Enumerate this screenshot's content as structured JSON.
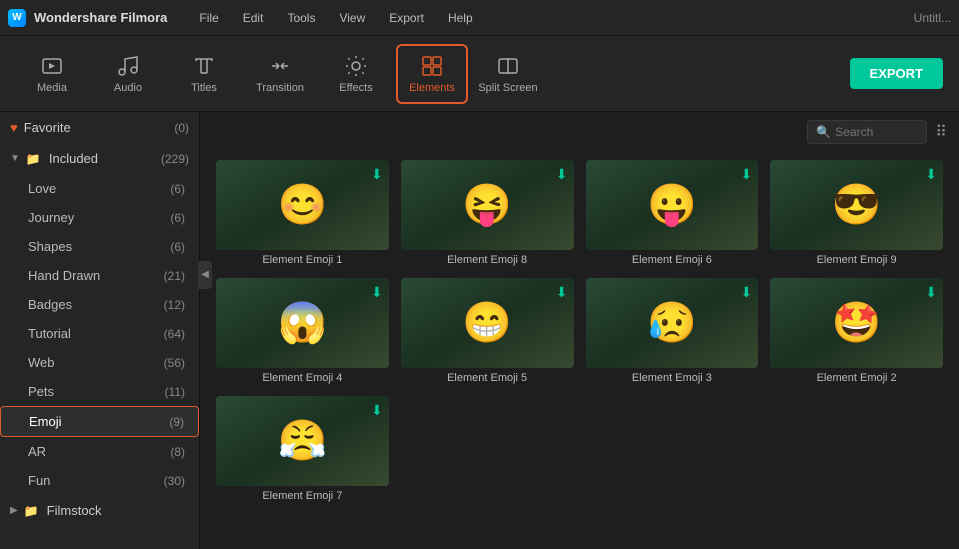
{
  "app": {
    "name": "Wondershare Filmora",
    "window_title": "Untitl..."
  },
  "menu": [
    "File",
    "Edit",
    "Tools",
    "View",
    "Export",
    "Help"
  ],
  "toolbar": {
    "export_label": "EXPORT",
    "buttons": [
      {
        "id": "media",
        "label": "Media",
        "icon": "media"
      },
      {
        "id": "audio",
        "label": "Audio",
        "icon": "audio"
      },
      {
        "id": "titles",
        "label": "Titles",
        "icon": "titles"
      },
      {
        "id": "transition",
        "label": "Transition",
        "icon": "transition"
      },
      {
        "id": "effects",
        "label": "Effects",
        "icon": "effects"
      },
      {
        "id": "elements",
        "label": "Elements",
        "icon": "elements",
        "active": true
      },
      {
        "id": "splitscreen",
        "label": "Split Screen",
        "icon": "splitscreen"
      }
    ]
  },
  "sidebar": {
    "sections": [
      {
        "id": "favorite",
        "label": "Favorite",
        "count": "(0)",
        "expanded": false,
        "icon": "heart"
      },
      {
        "id": "included",
        "label": "Included",
        "count": "(229)",
        "expanded": true,
        "children": [
          {
            "id": "love",
            "label": "Love",
            "count": "(6)"
          },
          {
            "id": "journey",
            "label": "Journey",
            "count": "(6)"
          },
          {
            "id": "shapes",
            "label": "Shapes",
            "count": "(6)"
          },
          {
            "id": "hand-drawn",
            "label": "Hand Drawn",
            "count": "(21)"
          },
          {
            "id": "badges",
            "label": "Badges",
            "count": "(12)"
          },
          {
            "id": "tutorial",
            "label": "Tutorial",
            "count": "(64)"
          },
          {
            "id": "web",
            "label": "Web",
            "count": "(56)"
          },
          {
            "id": "pets",
            "label": "Pets",
            "count": "(11)"
          },
          {
            "id": "emoji",
            "label": "Emoji",
            "count": "(9)",
            "active": true
          },
          {
            "id": "ar",
            "label": "AR",
            "count": "(8)"
          },
          {
            "id": "fun",
            "label": "Fun",
            "count": "(30)"
          }
        ]
      },
      {
        "id": "filmstock",
        "label": "Filmstock",
        "count": "",
        "expanded": false
      }
    ]
  },
  "search": {
    "placeholder": "Search"
  },
  "grid": {
    "items": [
      {
        "id": 1,
        "label": "Element Emoji 1",
        "emoji": "😊"
      },
      {
        "id": 8,
        "label": "Element Emoji 8",
        "emoji": "😝"
      },
      {
        "id": 6,
        "label": "Element Emoji 6",
        "emoji": "😛"
      },
      {
        "id": 9,
        "label": "Element Emoji 9",
        "emoji": "😎"
      },
      {
        "id": 4,
        "label": "Element Emoji 4",
        "emoji": "😱"
      },
      {
        "id": 5,
        "label": "Element Emoji 5",
        "emoji": "😁"
      },
      {
        "id": 3,
        "label": "Element Emoji 3",
        "emoji": "😥"
      },
      {
        "id": 2,
        "label": "Element Emoji 2",
        "emoji": "🤩"
      },
      {
        "id": 7,
        "label": "Element Emoji 7",
        "emoji": "😤"
      }
    ]
  }
}
